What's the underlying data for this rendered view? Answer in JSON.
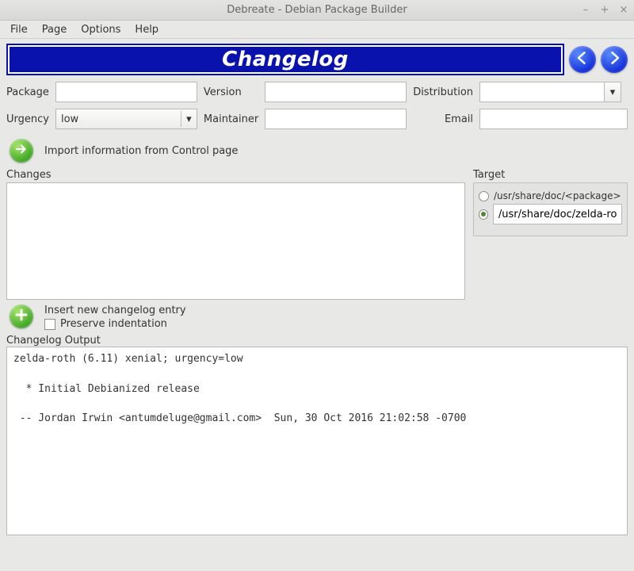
{
  "window": {
    "title": "Debreate - Debian Package Builder"
  },
  "menu": {
    "file": "File",
    "page": "Page",
    "options": "Options",
    "help": "Help"
  },
  "banner": {
    "title": "Changelog"
  },
  "fields": {
    "package_label": "Package",
    "package_value": "",
    "version_label": "Version",
    "version_value": "",
    "distribution_label": "Distribution",
    "distribution_value": "",
    "urgency_label": "Urgency",
    "urgency_value": "low",
    "maintainer_label": "Maintainer",
    "maintainer_value": "",
    "email_label": "Email",
    "email_value": ""
  },
  "import": {
    "label": "Import information from Control page"
  },
  "changes": {
    "label": "Changes",
    "value": ""
  },
  "target": {
    "label": "Target",
    "option1": "/usr/share/doc/<package>",
    "option2_value": "/usr/share/doc/zelda-roth"
  },
  "insert": {
    "label": "Insert new changelog entry",
    "preserve_label": "Preserve indentation"
  },
  "output": {
    "label": "Changelog Output",
    "text": "zelda-roth (6.11) xenial; urgency=low\n\n  * Initial Debianized release\n\n -- Jordan Irwin <antumdeluge@gmail.com>  Sun, 30 Oct 2016 21:02:58 -0700"
  }
}
